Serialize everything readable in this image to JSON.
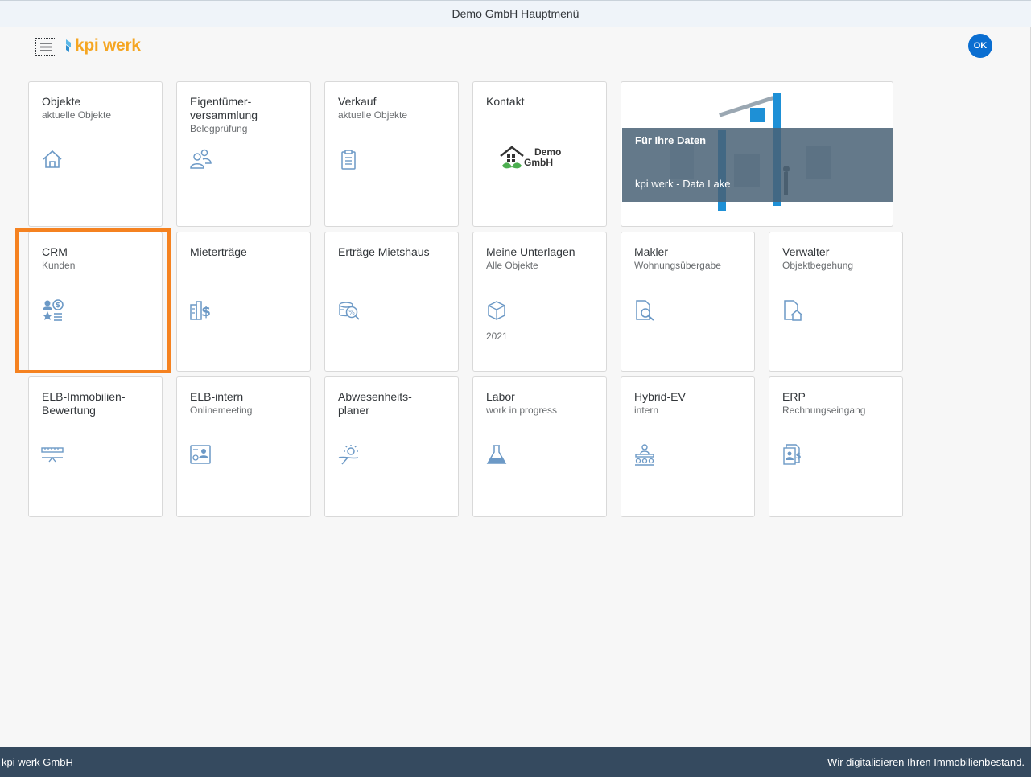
{
  "window": {
    "title": "Demo GmbH Hauptmenü"
  },
  "header": {
    "logo_text": "kpi werk",
    "avatar_initials": "OK",
    "menu_icon": "hamburger-icon"
  },
  "tiles": {
    "objekte": {
      "title": "Objekte",
      "subtitle": "aktuelle Objekte",
      "icon": "home-icon"
    },
    "eigentuemer": {
      "title": "Eigentümer-\nversammlung",
      "subtitle": "Belegprüfung",
      "icon": "people-icon"
    },
    "verkauf": {
      "title": "Verkauf",
      "subtitle": "aktuelle Objekte",
      "icon": "clipboard-icon"
    },
    "kontakt": {
      "title": "Kontakt",
      "logo_line1": "Demo",
      "logo_line2": "GmbH",
      "icon": "demo-gmbh-logo"
    },
    "banner": {
      "title": "Für Ihre Daten",
      "subtitle": "kpi werk - Data Lake"
    },
    "crm": {
      "title": "CRM",
      "subtitle": "Kunden",
      "icon": "customer-finance-icon"
    },
    "mietertraege": {
      "title": "Mieterträge",
      "icon": "building-dollar-icon"
    },
    "ertraege": {
      "title": "Erträge Mietshaus",
      "icon": "coin-percent-icon"
    },
    "unterlagen": {
      "title": "Meine Unterlagen",
      "subtitle": "Alle Objekte",
      "footer": "2021",
      "icon": "document-box-icon"
    },
    "makler": {
      "title": "Makler",
      "subtitle": "Wohnungsübergabe",
      "icon": "document-search-icon"
    },
    "verwalter": {
      "title": "Verwalter",
      "subtitle": "Objektbegehung",
      "icon": "document-home-icon"
    },
    "elb_bewertung": {
      "title": "ELB-Immobilien-\nBewertung",
      "icon": "measure-icon"
    },
    "elb_intern": {
      "title": "ELB-intern",
      "subtitle": "Onlinemeeting",
      "icon": "contact-card-icon"
    },
    "abwesenheit": {
      "title": "Abwesenheits-\nplaner",
      "icon": "vacation-icon"
    },
    "labor": {
      "title": "Labor",
      "subtitle": "work in progress",
      "icon": "flask-icon"
    },
    "hybrid": {
      "title": "Hybrid-EV",
      "subtitle": "intern",
      "icon": "meeting-icon"
    },
    "erp": {
      "title": "ERP",
      "subtitle": "Rechnungseingang",
      "icon": "invoice-icon"
    }
  },
  "footer": {
    "left": "kpi werk GmbH",
    "right": "Wir digitalisieren Ihren Immobilienbestand."
  },
  "colors": {
    "accent": "#0a6ed1",
    "icon": "#6c99c6",
    "highlight": "#f58220",
    "footer_bg": "#354a5f",
    "logo": "#f5a623"
  }
}
